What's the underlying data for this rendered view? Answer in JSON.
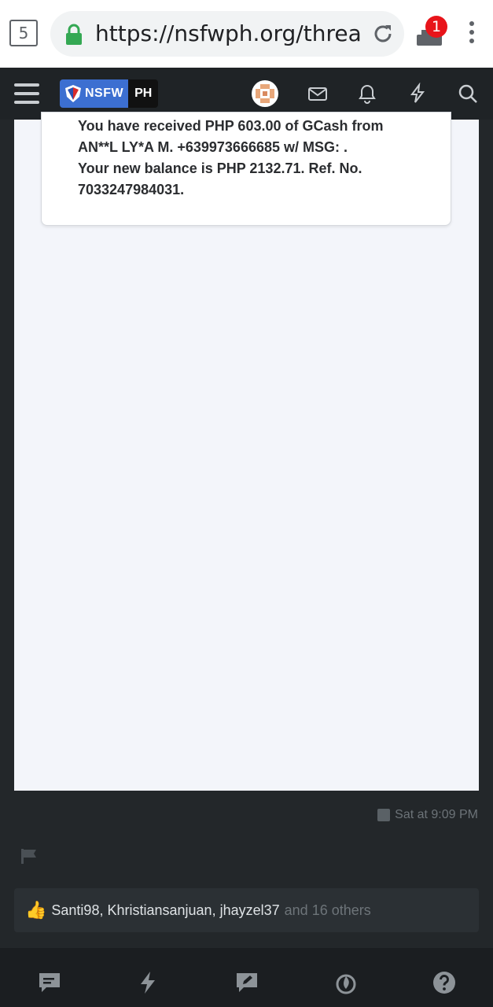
{
  "browser": {
    "tab_count": "5",
    "url": "https://nsfwph.org/threads/",
    "download_badge": "1"
  },
  "site": {
    "logo_left": "NSFW",
    "logo_right": "PH",
    "brand_color": "#3c6fd1"
  },
  "post": {
    "message_lines": [
      "You have received PHP 603.00 of GCash from",
      "AN**L LY*A M. +639973666685 w/ MSG: .",
      "Your new balance is PHP 2132.71. Ref. No.",
      "7033247984031."
    ],
    "timestamp": "Sat at 9:09 PM"
  },
  "reactions": {
    "users": [
      "Santi98",
      "Khristiansanjuan",
      "jhayzel37"
    ],
    "others": "and 16 others"
  },
  "bottom_nav": [
    "chat-icon",
    "lightning-icon",
    "write-icon",
    "fire-icon",
    "help-icon"
  ]
}
